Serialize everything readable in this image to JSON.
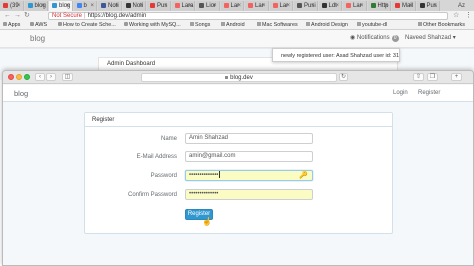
{
  "back_browser": {
    "tabs": [
      {
        "label": "(39",
        "favicon_color": "#e53935"
      },
      {
        "label": "blog",
        "favicon_color": "#3097d1"
      },
      {
        "label": "blog",
        "favicon_color": "#3097d1"
      },
      {
        "label": "b",
        "favicon_color": "#4285f4"
      },
      {
        "label": "Noti",
        "favicon_color": "#3b5998"
      },
      {
        "label": "Noti",
        "favicon_color": "#333333"
      },
      {
        "label": "Pus",
        "favicon_color": "#e53935"
      },
      {
        "label": "Lara",
        "favicon_color": "#f4645f"
      },
      {
        "label": "Lior",
        "favicon_color": "#555555"
      },
      {
        "label": "Lar",
        "favicon_color": "#f4645f"
      },
      {
        "label": "Lar",
        "favicon_color": "#f4645f"
      },
      {
        "label": "Lar",
        "favicon_color": "#f4645f"
      },
      {
        "label": "Pusi",
        "favicon_color": "#555555"
      },
      {
        "label": "Ldt",
        "favicon_color": "#333333"
      },
      {
        "label": "Lar",
        "favicon_color": "#f4645f"
      },
      {
        "label": "Http",
        "favicon_color": "#2e7d32"
      },
      {
        "label": "Mail",
        "favicon_color": "#e53935"
      },
      {
        "label": "Pus",
        "favicon_color": "#333333"
      }
    ],
    "tab_user": "Az",
    "url": {
      "security": "Not Secure",
      "scheme": "https://",
      "host": "blog.dev",
      "path": "/admin"
    },
    "bookmarks": [
      "Apps",
      "AWS",
      "How to Create Sche...",
      "Working with MySQ...",
      "Songs",
      "Android",
      "Mac Softwares",
      "Android Design",
      "youtube-dl",
      "Other Bookmarks"
    ],
    "app_brand": "blog",
    "notifications_label": "Notifications",
    "notifications_count": "0",
    "user_name": "Naveed Shahzad",
    "notification_text": "newly registered user: Asad Shahzad user id: 31",
    "panel_heading": "Admin Dashboard"
  },
  "front_browser": {
    "address": "blog.dev",
    "app_brand": "blog",
    "nav_links": {
      "login": "Login",
      "register": "Register"
    },
    "panel_heading": "Register",
    "form": {
      "name_label": "Name",
      "name_value": "Amin Shahzad",
      "email_label": "E-Mail Address",
      "email_value": "amin@gmail.com",
      "password_label": "Password",
      "password_value": "••••••••••••••",
      "confirm_label": "Confirm Password",
      "confirm_value": "••••••••••••••",
      "submit_label": "Register"
    }
  },
  "icons": {
    "window_close": "red-traffic-light",
    "window_minimize": "yellow-traffic-light",
    "window_zoom": "green-traffic-light",
    "key": "🔑"
  },
  "colors": {
    "primary": "#3097d1",
    "autofill": "#fafcc4",
    "panel_border": "#d3e0e9",
    "security_warning": "#d32f2f"
  }
}
